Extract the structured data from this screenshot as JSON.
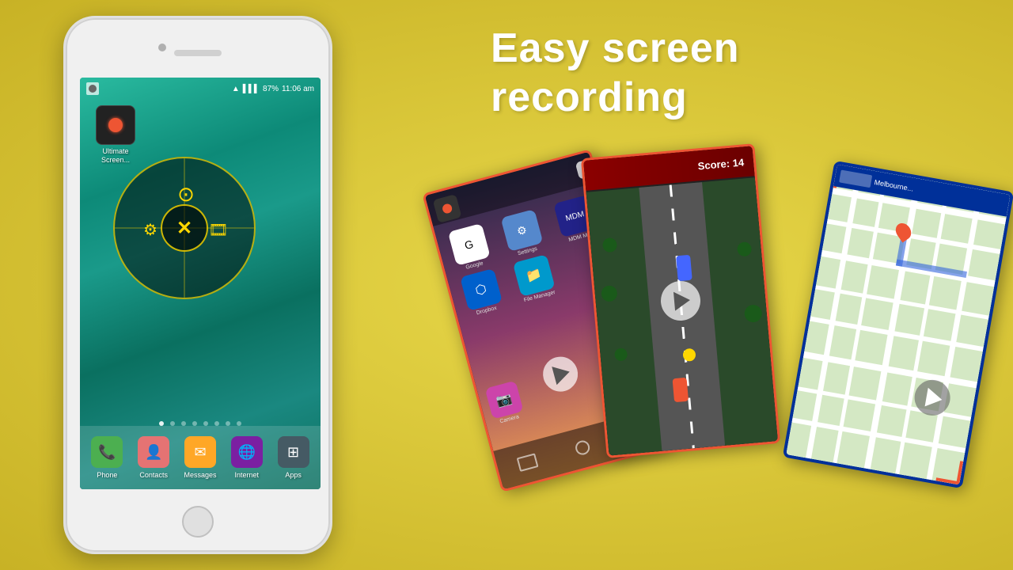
{
  "title": {
    "line1": "Easy screen",
    "line2": "recording"
  },
  "background_color": "#d4c030",
  "phone": {
    "status_bar": {
      "time": "11:06 am",
      "battery": "87%"
    },
    "home_app": {
      "label": "Ultimate\nScreen..."
    },
    "circular_menu": {
      "center_icon": "✕"
    },
    "page_dots": 8,
    "active_dot": 0,
    "dock": [
      {
        "label": "Phone",
        "color": "#4caf50",
        "icon": "📞"
      },
      {
        "label": "Contacts",
        "color": "#e57373",
        "icon": "👤"
      },
      {
        "label": "Messages",
        "color": "#ffa726",
        "icon": "✉"
      },
      {
        "label": "Internet",
        "color": "#7b1fa2",
        "icon": "🌐"
      },
      {
        "label": "Apps",
        "color": "#455a64",
        "icon": "⊞"
      }
    ]
  },
  "screenshots": {
    "card2_score": "Score: 14"
  }
}
